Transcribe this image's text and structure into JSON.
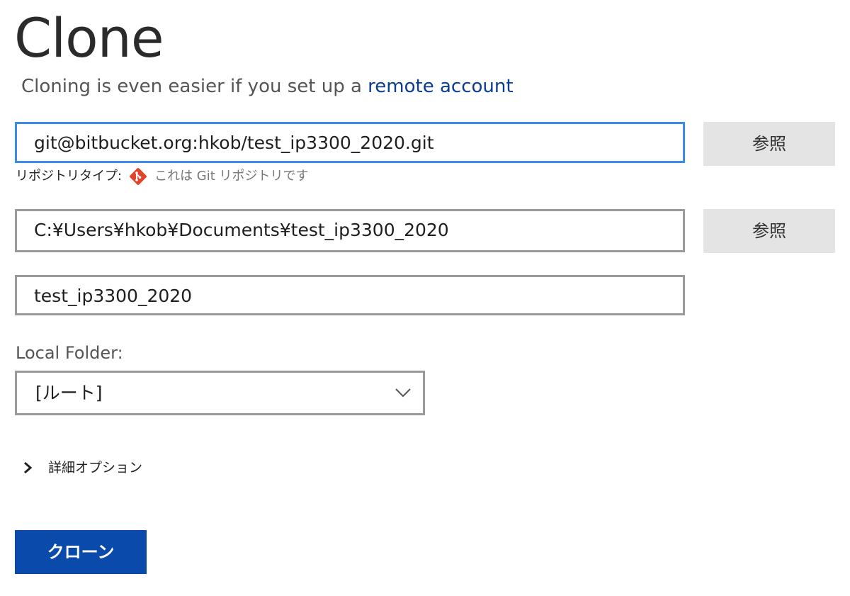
{
  "header": {
    "title": "Clone",
    "subtitle_prefix": "Cloning is even easier if you set up a ",
    "subtitle_link": "remote account"
  },
  "source": {
    "url_value": "git@bitbucket.org:hkob/test_ip3300_2020.git",
    "browse_label": "参照",
    "repo_type_label": "リポジトリタイプ:",
    "repo_type_message": "これは Git リポジトリです"
  },
  "destination": {
    "path_value": "C:¥Users¥hkob¥Documents¥test_ip3300_2020",
    "browse_label": "参照"
  },
  "name": {
    "value": "test_ip3300_2020"
  },
  "local_folder": {
    "label": "Local Folder:",
    "selected": "[ルート]"
  },
  "advanced_options": {
    "label": "詳細オプション"
  },
  "actions": {
    "clone_label": "クローン"
  },
  "colors": {
    "accent": "#0a4aaa",
    "focus_border": "#3c8be8",
    "link": "#0b3d91",
    "git_icon": "#e24329"
  }
}
